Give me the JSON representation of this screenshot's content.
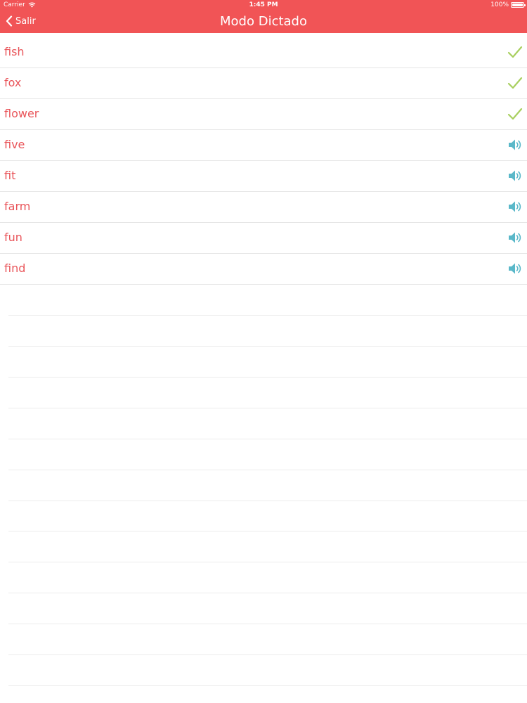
{
  "status_bar": {
    "carrier": "Carrier",
    "time": "1:45 PM",
    "battery": "100%",
    "wifi_icon": "wifi-icon",
    "battery_icon": "battery-icon"
  },
  "nav": {
    "back_label": "Salir",
    "back_icon": "chevron-left-icon",
    "title": "Modo Dictado"
  },
  "colors": {
    "header_bg": "#f15456",
    "word_text": "#e9555a",
    "check": "#a8cf5e",
    "speaker": "#5ab8c9",
    "divider": "#e6e6e6"
  },
  "words": [
    {
      "text": "fish",
      "status": "done",
      "icon": "checkmark-icon"
    },
    {
      "text": "fox",
      "status": "done",
      "icon": "checkmark-icon"
    },
    {
      "text": "flower",
      "status": "done",
      "icon": "checkmark-icon"
    },
    {
      "text": "five",
      "status": "pending",
      "icon": "speaker-icon"
    },
    {
      "text": "fit",
      "status": "pending",
      "icon": "speaker-icon"
    },
    {
      "text": "farm",
      "status": "pending",
      "icon": "speaker-icon"
    },
    {
      "text": "fun",
      "status": "pending",
      "icon": "speaker-icon"
    },
    {
      "text": "find",
      "status": "pending",
      "icon": "speaker-icon"
    }
  ]
}
